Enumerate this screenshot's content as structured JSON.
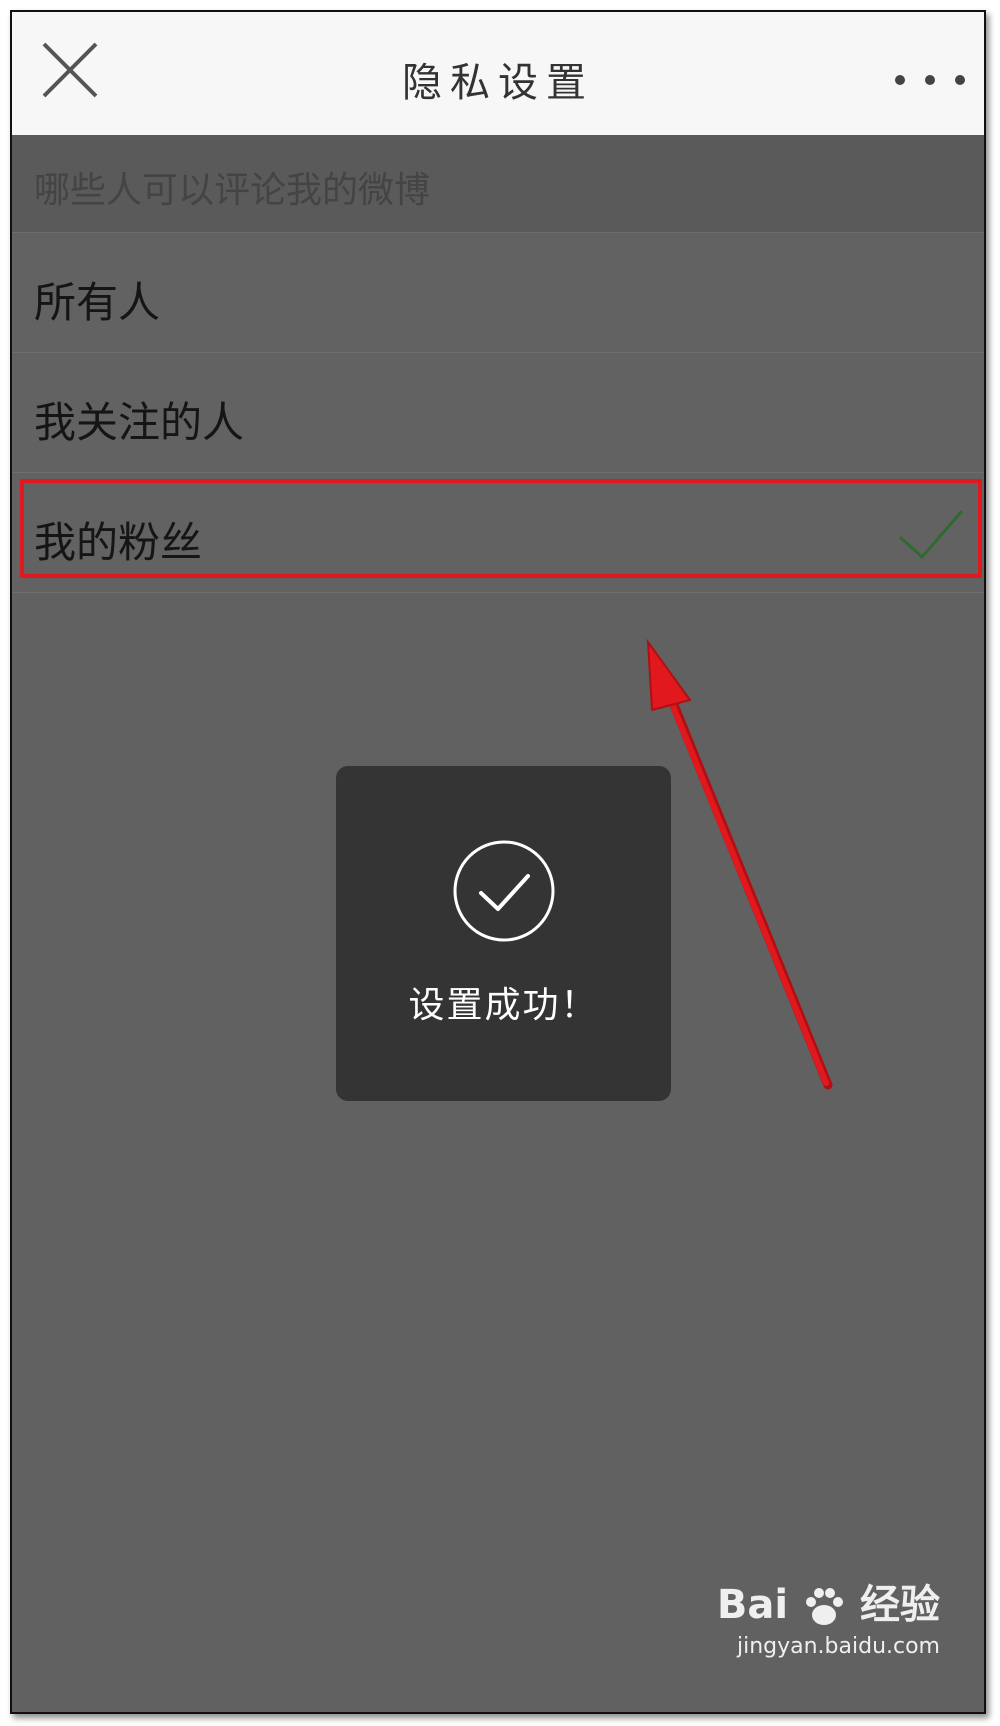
{
  "navbar": {
    "close_icon": "close-icon",
    "title": "隐私设置",
    "more_icon": "more-icon"
  },
  "section": {
    "header": "哪些人可以评论我的微博"
  },
  "options": [
    {
      "label": "所有人",
      "selected": false
    },
    {
      "label": "我关注的人",
      "selected": false
    },
    {
      "label": "我的粉丝",
      "selected": true
    }
  ],
  "toast": {
    "icon": "success-check-icon",
    "message": "设置成功！"
  },
  "annotation": {
    "color": "#e1191e"
  },
  "colors": {
    "overlay_bg": "#616161",
    "check_color": "#2f6b2f",
    "toast_bg": "#343434"
  },
  "watermark": {
    "brand": "Bai",
    "brand_tail": "经验",
    "url": "jingyan.baidu.com"
  }
}
